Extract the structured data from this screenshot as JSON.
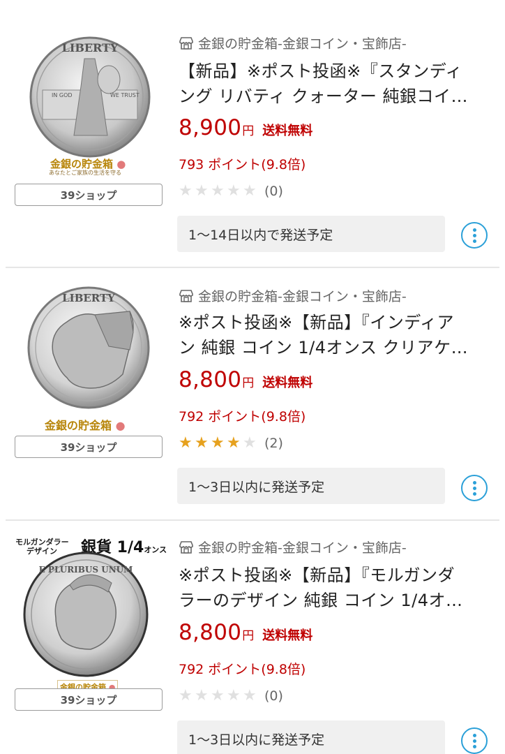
{
  "items": [
    {
      "store": "金銀の貯金箱-金銀コイン・宝飾店-",
      "title_line1": "【新品】※ポスト投函※『スタンディ",
      "title_line2": "ング リバティ クォーター 純銀コイ…",
      "price": "8,900",
      "yen": "円",
      "shipping": "送料無料",
      "points": "793 ポイント(9.8倍)",
      "stars_filled": 0,
      "review_count": "(0)",
      "delivery": "1〜14日以内で発送予定",
      "shop_badge": "39ショップ",
      "coin_text": "LIBERTY",
      "coin_sub_left": "IN GOD",
      "coin_sub_right": "WE TRUST",
      "watermark": "金銀の貯金箱",
      "watermark_sub": "あなたとご家族の生活を守る"
    },
    {
      "store": "金銀の貯金箱-金銀コイン・宝飾店-",
      "title_line1": "※ポスト投函※【新品】『インディア",
      "title_line2": "ン 純銀 コイン 1/4オンス クリアケ…",
      "price": "8,800",
      "yen": "円",
      "shipping": "送料無料",
      "points": "792 ポイント(9.8倍)",
      "stars_filled": 4,
      "review_count": "(2)",
      "delivery": "1〜3日以内に発送予定",
      "shop_badge": "39ショップ",
      "coin_text": "LIBERTY",
      "watermark": "金銀の貯金箱"
    },
    {
      "store": "金銀の貯金箱-金銀コイン・宝飾店-",
      "title_line1": "※ポスト投函※【新品】『モルガンダ",
      "title_line2": "ラーのデザイン 純銀 コイン 1/4オ…",
      "price": "8,800",
      "yen": "円",
      "shipping": "送料無料",
      "points": "792 ポイント(9.8倍)",
      "stars_filled": 0,
      "review_count": "(0)",
      "delivery": "1〜3日以内に発送予定",
      "shop_badge": "39ショップ",
      "banner_left_1": "モルガンダラー",
      "banner_left_2": "デザイン",
      "banner_main": "銀貨 1/4",
      "banner_unit": "オンス",
      "coin_text": "E PLURIBUS UNUM",
      "watermark": "金銀の貯金箱"
    }
  ],
  "colors": {
    "price_red": "#bf0000",
    "star_gold": "#e6a11e",
    "star_empty": "#e0e0e0",
    "accent_blue": "#2ba0d8"
  }
}
